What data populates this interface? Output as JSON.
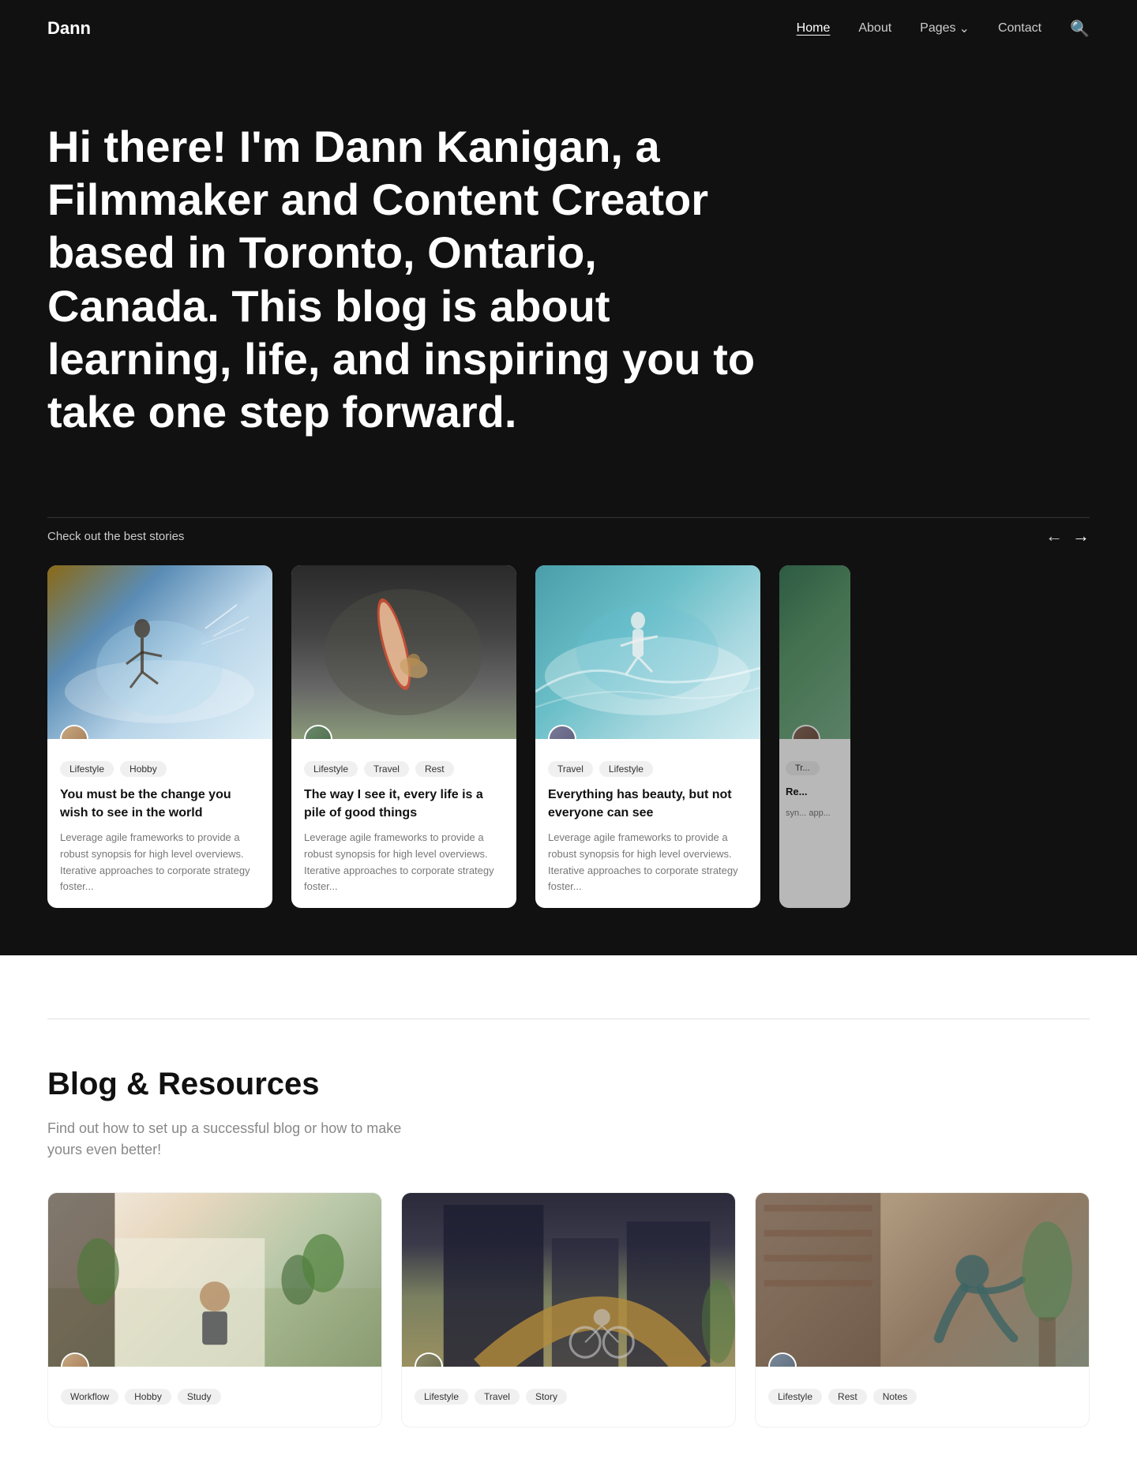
{
  "nav": {
    "logo": "Dann",
    "links": [
      {
        "label": "Home",
        "active": true
      },
      {
        "label": "About",
        "active": false
      },
      {
        "label": "Pages",
        "active": false,
        "has_dropdown": true
      },
      {
        "label": "Contact",
        "active": false
      }
    ],
    "search_icon": "search"
  },
  "hero": {
    "heading": "Hi there! I'm Dann Kanigan, a Filmmaker and Content Creator based in Toronto, Ontario, Canada. This blog is about learning, life, and inspiring you to take one step forward."
  },
  "stories": {
    "section_label": "Check out the best stories",
    "nav_prev": "←",
    "nav_next": "→",
    "cards": [
      {
        "tags": [
          "Lifestyle",
          "Hobby"
        ],
        "title": "You must be the change you wish to see in the world",
        "excerpt": "Leverage agile frameworks to provide a robust synopsis for high level overviews. Iterative approaches to corporate strategy foster..."
      },
      {
        "tags": [
          "Lifestyle",
          "Travel",
          "Rest"
        ],
        "title": "The way I see it, every life is a pile of good things",
        "excerpt": "Leverage agile frameworks to provide a robust synopsis for high level overviews. Iterative approaches to corporate strategy foster..."
      },
      {
        "tags": [
          "Travel",
          "Lifestyle"
        ],
        "title": "Everything has beauty, but not everyone can see",
        "excerpt": "Leverage agile frameworks to provide a robust synopsis for high level overviews. Iterative approaches to corporate strategy foster..."
      },
      {
        "tags": [
          "Tr..."
        ],
        "title": "Re...",
        "excerpt": "syn... app..."
      }
    ]
  },
  "blog": {
    "heading": "Blog & Resources",
    "subtitle": "Find out how to set up a successful blog or how to make yours even better!",
    "cards": [
      {
        "tags": [
          "Workflow",
          "Hobby",
          "Study"
        ],
        "title": "",
        "excerpt": ""
      },
      {
        "tags": [
          "Lifestyle",
          "Travel",
          "Story"
        ],
        "title": "",
        "excerpt": ""
      },
      {
        "tags": [
          "Lifestyle",
          "Rest",
          "Notes"
        ],
        "title": "",
        "excerpt": ""
      }
    ]
  }
}
